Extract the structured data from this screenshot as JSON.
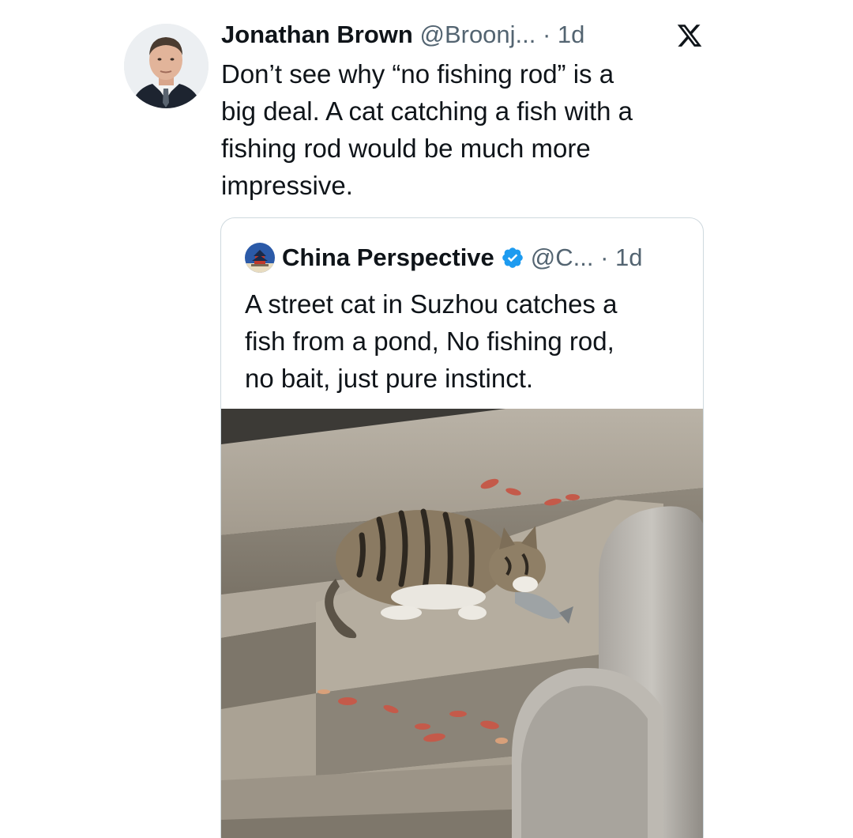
{
  "tweet": {
    "author_name": "Jonathan Brown",
    "author_meta": "@Broonj... · 1d",
    "text_lines": [
      "Don’t see why “no fishing rod” is a",
      "big deal. A cat catching a fish with a",
      "fishing rod would be much more",
      "impressive."
    ],
    "platform_icon": "x-logo-icon"
  },
  "quote": {
    "author_name": "China Perspective",
    "verified_icon": "verified-badge-icon",
    "author_meta": "@C... · 1d",
    "text_lines": [
      "A street cat in Suzhou catches a",
      "fish from a pond, No fishing rod,",
      "no bait, just pure instinct."
    ],
    "media_subject": "photo of a tabby cat eating a fish on stone steps"
  },
  "colors": {
    "text_primary": "#0f1419",
    "text_secondary": "#536471",
    "card_border": "#cfd9de",
    "verified_blue": "#1d9bf0"
  }
}
